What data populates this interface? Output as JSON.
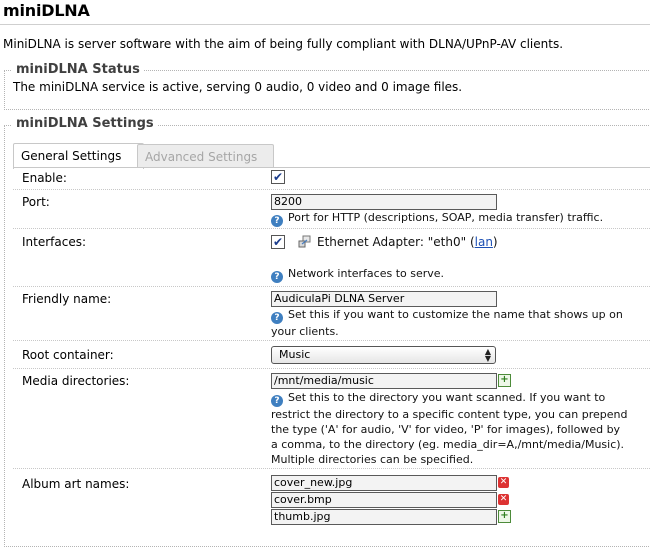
{
  "page": {
    "title": "miniDLNA",
    "intro": "MiniDLNA is server software with the aim of being fully compliant with DLNA/UPnP-AV clients."
  },
  "status_section": {
    "legend": "miniDLNA Status",
    "text": "The miniDLNA service is active, serving 0 audio, 0 video and 0 image files."
  },
  "settings_section": {
    "legend": "miniDLNA Settings",
    "tabs": [
      {
        "label": "General Settings",
        "active": true
      },
      {
        "label": "Advanced Settings",
        "active": false
      }
    ]
  },
  "fields": {
    "enable": {
      "label": "Enable:",
      "checked": true
    },
    "port": {
      "label": "Port:",
      "value": "8200",
      "help": "Port for HTTP (descriptions, SOAP, media transfer) traffic."
    },
    "interfaces": {
      "label": "Interfaces:",
      "adapter_text": "Ethernet Adapter: \"eth0\" (",
      "adapter_link": "lan",
      "adapter_close": ")",
      "checked": true,
      "help": "Network interfaces to serve."
    },
    "friendly_name": {
      "label": "Friendly name:",
      "value": "AudiculaPi DLNA Server",
      "help_line1": "Set this if you want to customize the name that shows up on",
      "help_line2": "your clients."
    },
    "root_container": {
      "label": "Root container:",
      "selected": "Music"
    },
    "media_dirs": {
      "label": "Media directories:",
      "value": "/mnt/media/music",
      "help_lines": [
        "Set this to the directory you want scanned. If you want to",
        "restrict the directory to a specific content type, you can prepend",
        "the type ('A' for audio, 'V' for video, 'P' for images), followed by",
        "a comma, to the directory (eg. media_dir=A,/mnt/media/Music).",
        "Multiple directories can be specified."
      ]
    },
    "album_art": {
      "label": "Album art names:",
      "values": [
        "cover_new.jpg",
        "cover.bmp",
        "thumb.jpg"
      ]
    }
  },
  "icons": {
    "help": "help-icon",
    "add": "add-icon",
    "remove": "remove-icon",
    "network": "network-adapter-icon"
  },
  "colors": {
    "link": "#1c4fb4",
    "help_icon": "#3f7fc0",
    "remove": "#dd3333",
    "add": "#2e7d1e"
  }
}
